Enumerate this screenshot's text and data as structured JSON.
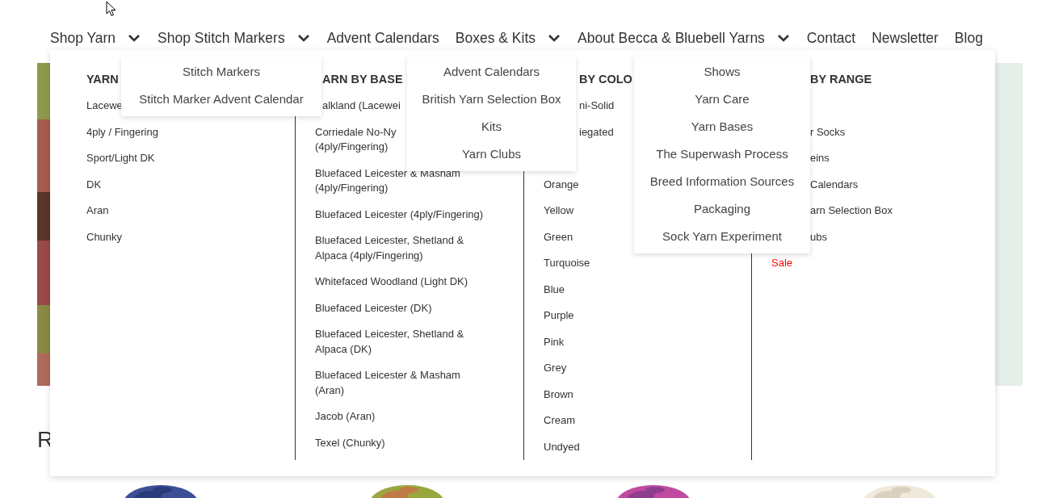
{
  "nav": [
    {
      "label": "Shop Yarn",
      "kind": "dropdown"
    },
    {
      "label": "Shop Stitch Markers",
      "kind": "dropdown"
    },
    {
      "label": "Advent Calendars",
      "kind": "link"
    },
    {
      "label": "Boxes & Kits",
      "kind": "dropdown"
    },
    {
      "label": "About Becca & Bluebell Yarns",
      "kind": "dropdown"
    },
    {
      "label": "Contact",
      "kind": "link"
    },
    {
      "label": "Newsletter",
      "kind": "link"
    },
    {
      "label": "Blog",
      "kind": "link"
    }
  ],
  "mega_menu": {
    "columns": [
      {
        "heading": "YARN",
        "items": [
          {
            "label": "Lacewe",
            "kind": "link"
          },
          {
            "label": "4ply / Fingering",
            "kind": "link"
          },
          {
            "label": "Sport/Light DK",
            "kind": "link"
          },
          {
            "label": "DK",
            "kind": "link"
          },
          {
            "label": "Aran",
            "kind": "link"
          },
          {
            "label": "Chunky",
            "kind": "link"
          }
        ]
      },
      {
        "heading": "ARN BY BASE",
        "items": [
          {
            "label": "alkland (Lacewei",
            "kind": "cut"
          },
          {
            "label": "Corriedale No-Ny\n(4ply/Fingering)",
            "kind": "link"
          },
          {
            "label": "Bluefaced Leicester & Masham\n(4ply/Fingering)",
            "kind": "link"
          },
          {
            "label": "Bluefaced Leicester (4ply/Fingering)",
            "kind": "link"
          },
          {
            "label": "Bluefaced Leicester, Shetland &\nAlpaca (4ply/Fingering)",
            "kind": "link"
          },
          {
            "label": "Whitefaced Woodland (Light DK)",
            "kind": "link"
          },
          {
            "label": "Bluefaced Leicester (DK)",
            "kind": "link"
          },
          {
            "label": "Bluefaced Leicester, Shetland &\nAlpaca (DK)",
            "kind": "link"
          },
          {
            "label": "Bluefaced Leicester & Masham\n(Aran)",
            "kind": "link"
          },
          {
            "label": "Jacob (Aran)",
            "kind": "link"
          },
          {
            "label": "Texel (Chunky)",
            "kind": "link"
          }
        ]
      },
      {
        "heading": "BY COLO",
        "items": [
          {
            "label": "ni-Solid",
            "kind": "cut"
          },
          {
            "label": "iegated",
            "kind": "cut"
          },
          {
            "label": "Orange",
            "kind": "after-hidden"
          },
          {
            "label": "Yellow",
            "kind": "link"
          },
          {
            "label": "Green",
            "kind": "link"
          },
          {
            "label": "Turquoise",
            "kind": "link"
          },
          {
            "label": "Blue",
            "kind": "link"
          },
          {
            "label": "Purple",
            "kind": "link"
          },
          {
            "label": "Pink",
            "kind": "link"
          },
          {
            "label": "Grey",
            "kind": "link"
          },
          {
            "label": "Brown",
            "kind": "link"
          },
          {
            "label": "Cream",
            "kind": "link"
          },
          {
            "label": "Undyed",
            "kind": "link"
          }
        ]
      },
      {
        "heading": "BY RANGE",
        "items": [
          {
            "label": "r Socks",
            "kind": "cut-after-hidden"
          },
          {
            "label": "eins",
            "kind": "cut"
          },
          {
            "label": "Calendars",
            "kind": "cut"
          },
          {
            "label": "arn Selection Box",
            "kind": "cut"
          },
          {
            "label": "ubs",
            "kind": "cut"
          },
          {
            "label": "Sale",
            "kind": "sale"
          }
        ]
      }
    ]
  },
  "dropdowns": [
    {
      "items": [
        "Stitch Markers",
        "Stitch Marker Advent Calendar"
      ]
    },
    {
      "items": [
        "Advent Calendars",
        "British Yarn Selection Box",
        "Kits",
        "Yarn Clubs"
      ]
    },
    {
      "items": [
        "Shows",
        "Yarn Care",
        "Yarn Bases",
        "The Superwash Process",
        "Breed Information Sources",
        "Packaging",
        "Sock Yarn Experiment"
      ]
    }
  ],
  "section_heading": "R"
}
